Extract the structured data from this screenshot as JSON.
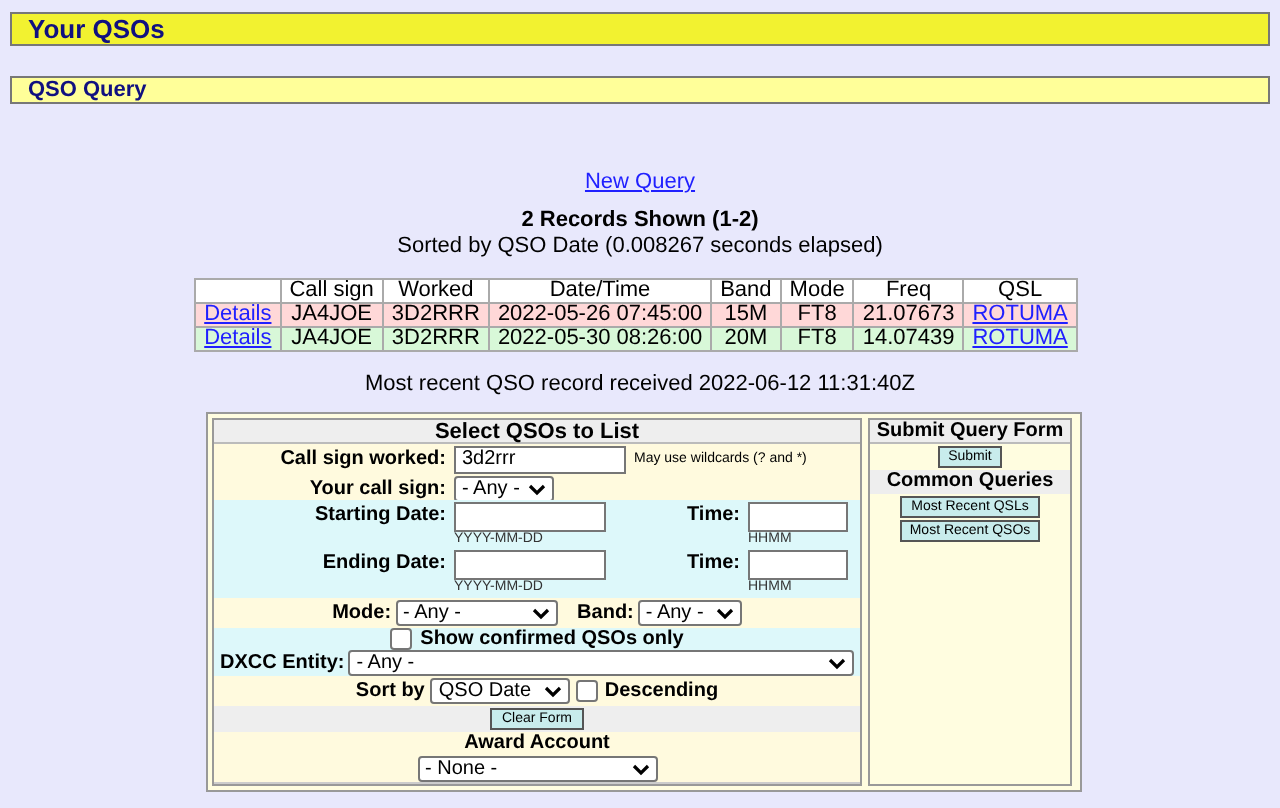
{
  "header": {
    "title": "Your QSOs"
  },
  "section": {
    "title": "QSO Query"
  },
  "new_query_link": "New Query",
  "summary": {
    "heading": "2 Records Shown (1-2)",
    "sorted": "Sorted by QSO Date (0.008267 seconds elapsed)"
  },
  "table": {
    "columns": [
      "",
      "Call sign",
      "Worked",
      "Date/Time",
      "Band",
      "Mode",
      "Freq",
      "QSL"
    ],
    "rows": [
      {
        "details": "Details",
        "call_sign": "JA4JOE",
        "worked": "3D2RRR",
        "date_time": "2022-05-26 07:45:00",
        "band": "15M",
        "mode": "FT8",
        "freq": "21.07673",
        "qsl": "ROTUMA",
        "color": "#ffd8d8"
      },
      {
        "details": "Details",
        "call_sign": "JA4JOE",
        "worked": "3D2RRR",
        "date_time": "2022-05-30 08:26:00",
        "band": "20M",
        "mode": "FT8",
        "freq": "14.07439",
        "qsl": "ROTUMA",
        "color": "#d8f8d8"
      }
    ]
  },
  "most_recent": "Most recent QSO record received 2022-06-12 11:31:40Z",
  "form": {
    "title": "Select QSOs to List",
    "call_sign_worked": {
      "label": "Call sign worked:",
      "value": "3d2rrr",
      "hint": "May use wildcards (? and *)"
    },
    "your_call_sign": {
      "label": "Your call sign:",
      "value": "- Any -"
    },
    "starting_date": {
      "label": "Starting Date:",
      "hint": "YYYY-MM-DD",
      "time_label": "Time:",
      "time_hint": "HHMM"
    },
    "ending_date": {
      "label": "Ending Date:",
      "hint": "YYYY-MM-DD",
      "time_label": "Time:",
      "time_hint": "HHMM"
    },
    "mode": {
      "label": "Mode:",
      "value": "- Any -"
    },
    "band": {
      "label": "Band:",
      "value": "- Any -"
    },
    "confirmed_only": {
      "label": "Show confirmed QSOs only",
      "checked": false
    },
    "dxcc": {
      "label": "DXCC Entity:",
      "value": "- Any -"
    },
    "sort_by": {
      "label": "Sort by",
      "value": "QSO Date"
    },
    "descending": {
      "label": "Descending",
      "checked": false
    },
    "clear_button": "Clear Form",
    "award_account": {
      "label": "Award Account",
      "value": "- None -"
    }
  },
  "side": {
    "submit_title": "Submit Query Form",
    "submit_button": "Submit",
    "common_title": "Common Queries",
    "buttons": [
      "Most Recent QSLs",
      "Most Recent QSOs"
    ]
  }
}
